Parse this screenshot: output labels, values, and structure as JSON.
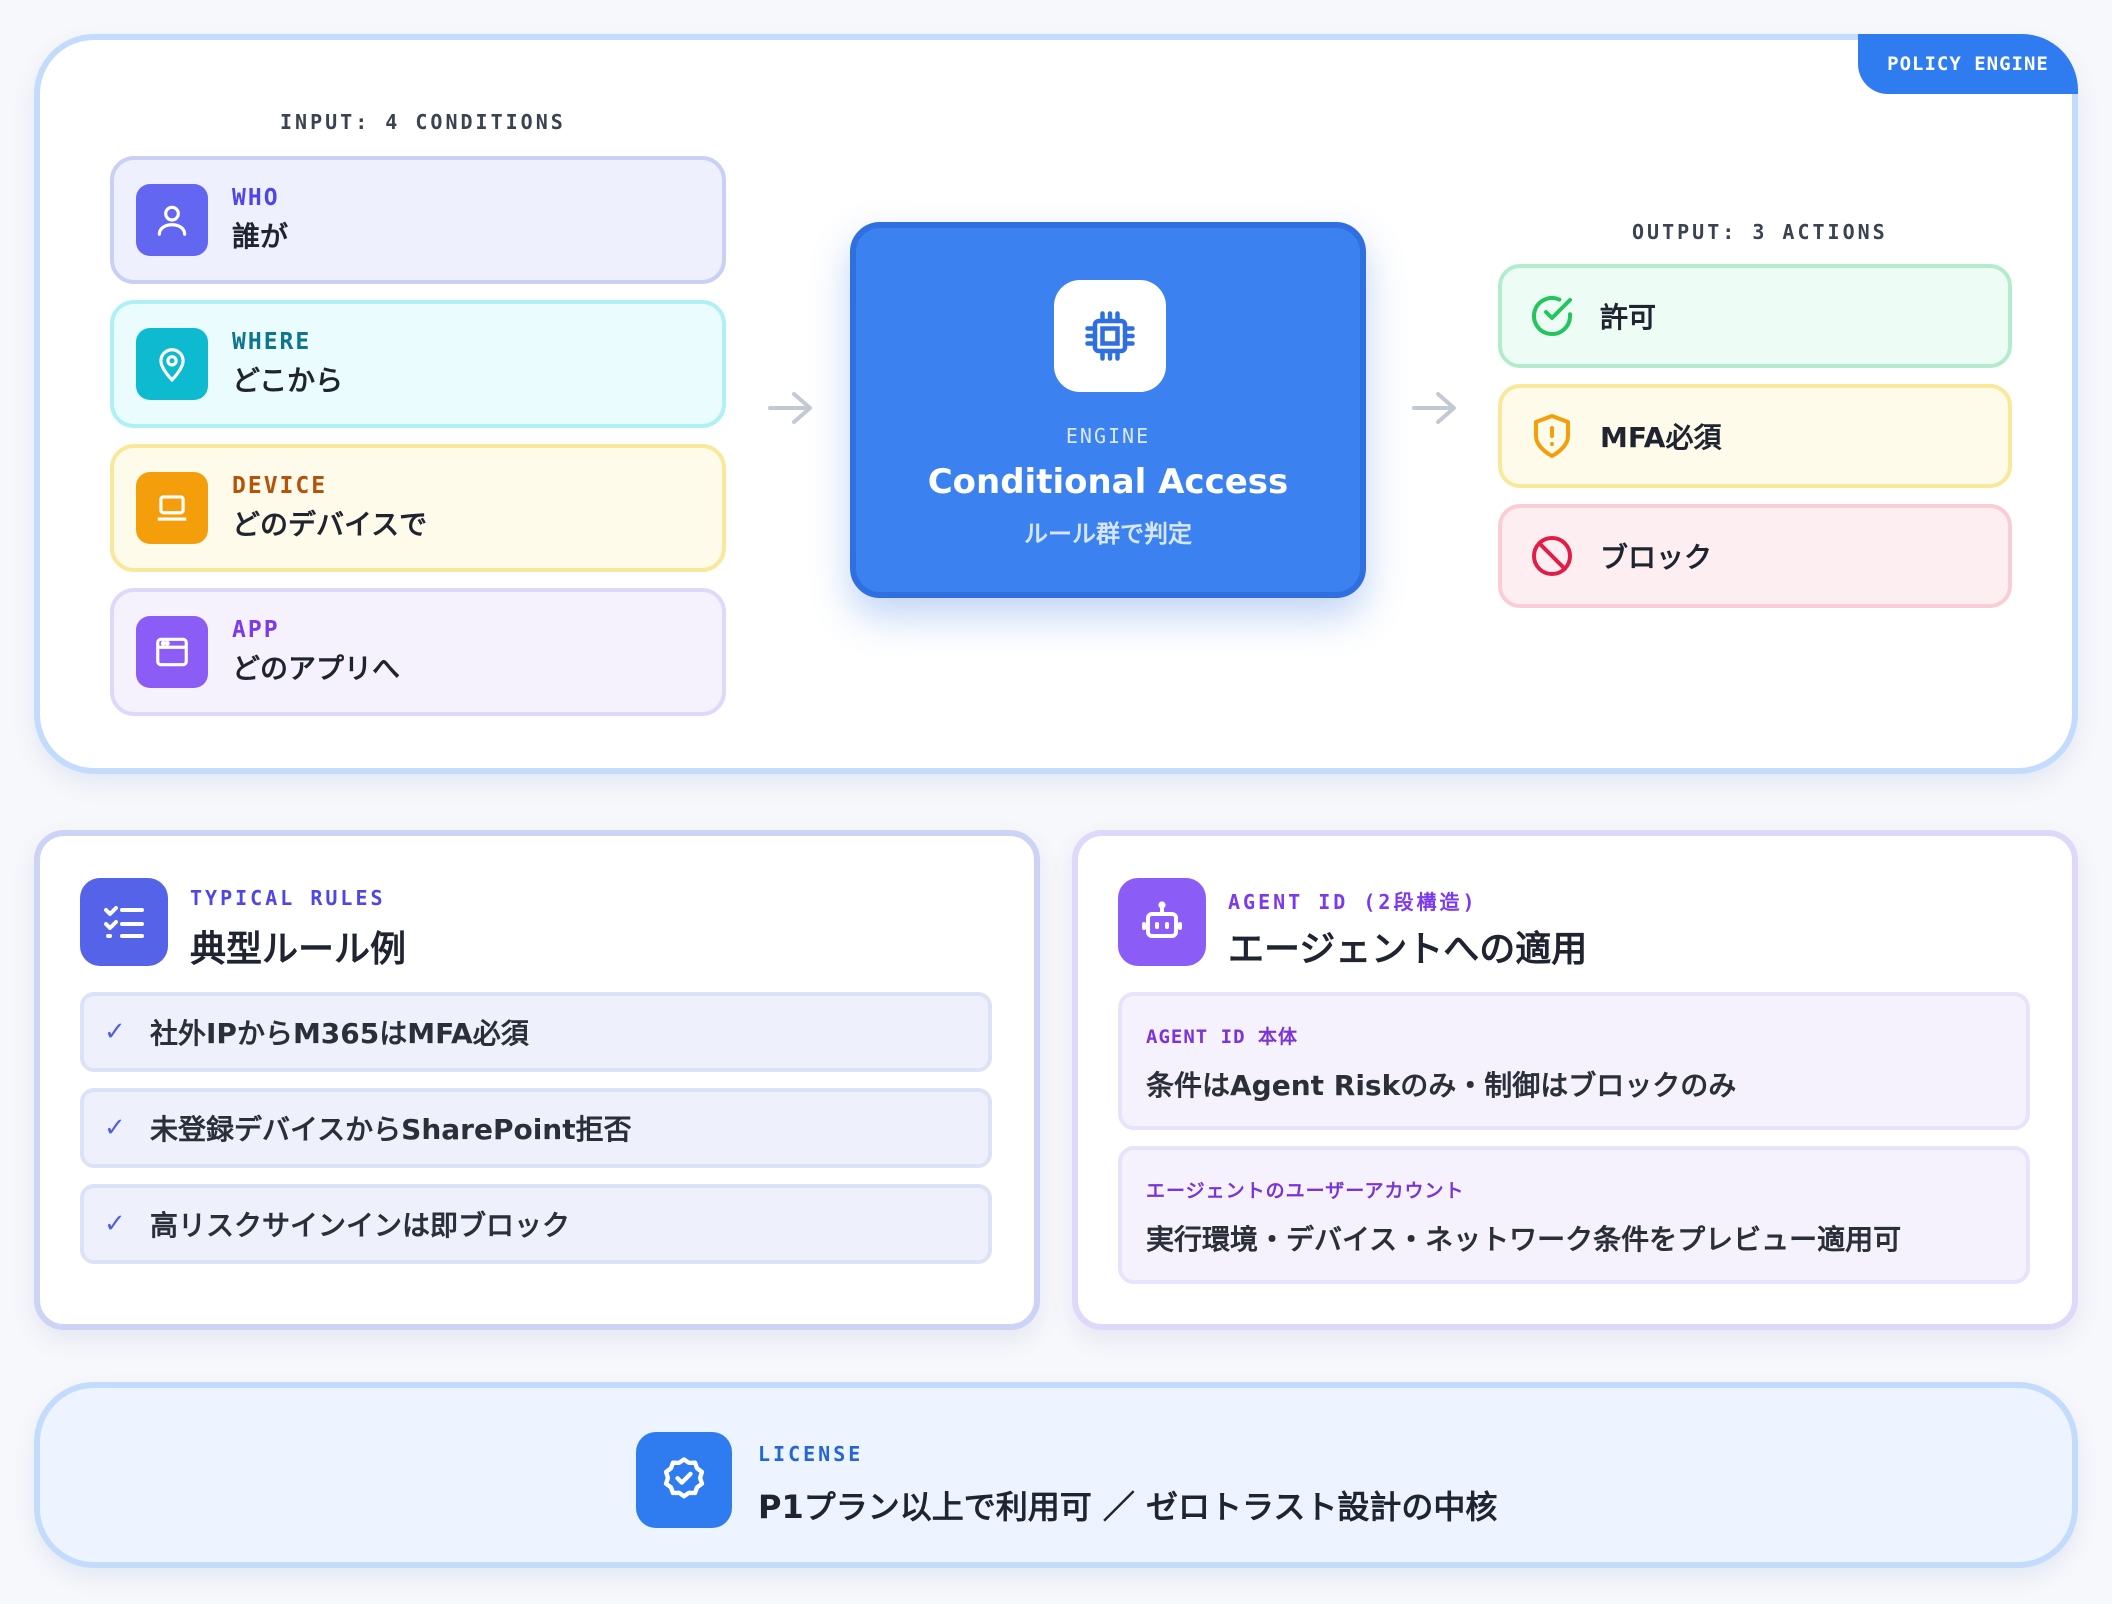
{
  "policy_tag": "POLICY ENGINE",
  "input": {
    "caption": "INPUT: 4 CONDITIONS",
    "conditions": [
      {
        "label": "WHO",
        "ja": "誰が",
        "icon": "user-icon",
        "color": "#6366f1"
      },
      {
        "label": "WHERE",
        "ja": "どこから",
        "icon": "location-pin-icon",
        "color": "#0ea5c4"
      },
      {
        "label": "DEVICE",
        "ja": "どのデバイスで",
        "icon": "laptop-icon",
        "color": "#f59e0b"
      },
      {
        "label": "APP",
        "ja": "どのアプリへ",
        "icon": "app-window-icon",
        "color": "#8b5cf6"
      }
    ]
  },
  "engine": {
    "label": "ENGINE",
    "title": "Conditional Access",
    "subtitle": "ルール群で判定",
    "icon": "cpu-chip-icon",
    "color": "#3b82f0"
  },
  "output": {
    "caption": "OUTPUT: 3 ACTIONS",
    "actions": [
      {
        "label": "許可",
        "icon": "check-circle-icon",
        "color": "#22c55e"
      },
      {
        "label": "MFA必須",
        "icon": "shield-alert-icon",
        "color": "#f59e0b"
      },
      {
        "label": "ブロック",
        "icon": "block-icon",
        "color": "#e11d48"
      }
    ]
  },
  "rules_card": {
    "caption": "TYPICAL RULES",
    "title": "典型ルール例",
    "icon": "checklist-icon",
    "items": [
      "社外IPからM365はMFA必須",
      "未登録デバイスからSharePoint拒否",
      "高リスクサインインは即ブロック"
    ]
  },
  "agent_card": {
    "caption": "AGENT ID (2段構造)",
    "title": "エージェントへの適用",
    "icon": "robot-icon",
    "blocks": [
      {
        "label": "AGENT ID 本体",
        "text": "条件はAgent Riskのみ・制御はブロックのみ"
      },
      {
        "label": "エージェントのユーザーアカウント",
        "text": "実行環境・デバイス・ネットワーク条件をプレビュー適用可"
      }
    ]
  },
  "license": {
    "caption": "LICENSE",
    "text": "P1プラン以上で利用可 ／ ゼロトラスト設計の中核",
    "icon": "verified-badge-icon"
  }
}
